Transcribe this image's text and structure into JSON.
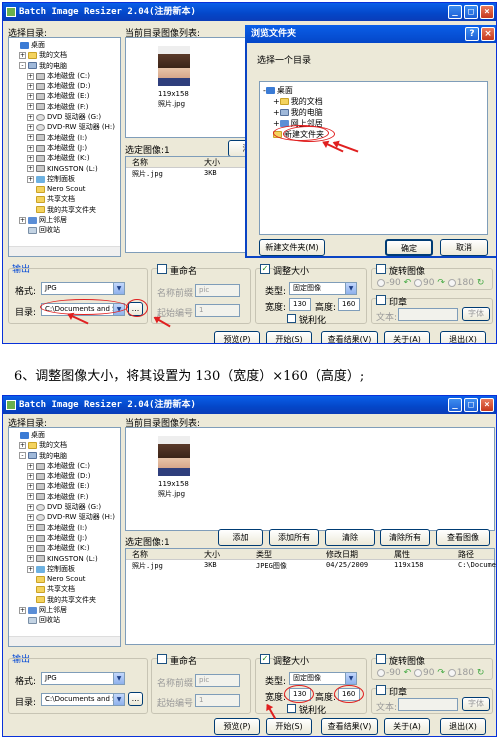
{
  "app": {
    "title": "Batch Image Resizer 2.04(注册新本)"
  },
  "labels": {
    "select_dir": "选择目录:",
    "current_dir_images": "当前目录图像列表:",
    "selected_count": "选定图像:1",
    "output": "输出",
    "format": "格式:",
    "directory": "目录:",
    "rename": "重命名",
    "name_prefix": "名称前缀",
    "start_number": "起始编号",
    "resize": "调整大小",
    "type": "类型:",
    "width": "宽度:",
    "height": "高度:",
    "sharpen": "锐利化",
    "rotate": "旋转图像",
    "watermark": "印章",
    "text": "文本:",
    "font": "字体"
  },
  "tree": [
    {
      "label": "桌面",
      "icon": "desktop-icon",
      "level": 0
    },
    {
      "label": "我的文档",
      "icon": "folder-icon",
      "level": 1,
      "toggle": "+"
    },
    {
      "label": "我的电脑",
      "icon": "computer-icon",
      "level": 1,
      "toggle": "-"
    },
    {
      "label": "本地磁盘 (C:)",
      "icon": "drive-icon",
      "level": 2,
      "toggle": "+"
    },
    {
      "label": "本地磁盘 (D:)",
      "icon": "drive-icon",
      "level": 2,
      "toggle": "+"
    },
    {
      "label": "本地磁盘 (E:)",
      "icon": "drive-icon",
      "level": 2,
      "toggle": "+"
    },
    {
      "label": "本地磁盘 (F:)",
      "icon": "drive-icon",
      "level": 2,
      "toggle": "+"
    },
    {
      "label": "DVD 驱动器 (G:)",
      "icon": "cd-icon",
      "level": 2,
      "toggle": "+"
    },
    {
      "label": "DVD-RW 驱动器 (H:)",
      "icon": "cd-icon",
      "level": 2,
      "toggle": "+"
    },
    {
      "label": "本地磁盘 (I:)",
      "icon": "drive-icon",
      "level": 2,
      "toggle": "+"
    },
    {
      "label": "本地磁盘 (J:)",
      "icon": "drive-icon",
      "level": 2,
      "toggle": "+"
    },
    {
      "label": "本地磁盘 (K:)",
      "icon": "drive-icon",
      "level": 2,
      "toggle": "+"
    },
    {
      "label": "KINGSTON (L:)",
      "icon": "drive-icon",
      "level": 2,
      "toggle": "+"
    },
    {
      "label": "控制面板",
      "icon": "control-panel-icon",
      "level": 2,
      "toggle": "+"
    },
    {
      "label": "Nero Scout",
      "icon": "folder-icon",
      "level": 2
    },
    {
      "label": "共享文档",
      "icon": "folder-icon",
      "level": 2
    },
    {
      "label": "我的共享文件夹",
      "icon": "folder-icon",
      "level": 2
    },
    {
      "label": "网上邻居",
      "icon": "network-icon",
      "level": 1,
      "toggle": "+"
    },
    {
      "label": "回收站",
      "icon": "recycle-bin-icon",
      "level": 1
    }
  ],
  "thumbnail": {
    "size": "119x158",
    "name": "照片.jpg"
  },
  "buttons": {
    "add": "添加",
    "add_all": "添加所有",
    "clear": "清除",
    "clear_all": "清除所有",
    "view_image": "查看图像",
    "preview": "预览(P)",
    "start": "开始(S)",
    "view_result": "查看结果(V)",
    "about": "关于(A)",
    "exit": "退出(X)",
    "browse": "..."
  },
  "file_list": {
    "columns": [
      "名称",
      "大小",
      "类型",
      "修改日期",
      "属性",
      "路径"
    ],
    "rows": [
      [
        "照片.jpg",
        "3KB",
        "JPEG图像",
        "04/25/2009",
        "119x158",
        "C:\\Docume"
      ]
    ]
  },
  "output": {
    "format_value": "JPG",
    "dir_value": "C:\\Documents and S",
    "prefix_value": "pic",
    "start_value": "1"
  },
  "resize": {
    "type_value": "固定图像",
    "width": "130",
    "height": "160"
  },
  "rotate": {
    "options": [
      "-90",
      "90",
      "180"
    ]
  },
  "dialog": {
    "title": "浏览文件夹",
    "help": "?",
    "close": "×",
    "prompt": "选择一个目录",
    "tree": [
      {
        "label": "桌面",
        "icon": "desktop-icon",
        "level": 0,
        "toggle": "-"
      },
      {
        "label": "我的文档",
        "icon": "folder-icon",
        "level": 1,
        "toggle": "+"
      },
      {
        "label": "我的电脑",
        "icon": "computer-icon",
        "level": 1,
        "toggle": "+"
      },
      {
        "label": "网上邻居",
        "icon": "network-icon",
        "level": 1,
        "toggle": "+"
      },
      {
        "label": "新建文件夹",
        "icon": "folder-icon",
        "level": 1
      }
    ],
    "new_folder": "新建文件夹(M)",
    "ok": "确定",
    "cancel": "取消"
  },
  "caption": "6、调整图像大小，将其设置为 130（宽度）×160（高度）;",
  "colors": {
    "titlebar": "#0a5fe8",
    "annotation": "#e02020",
    "face": "#ece9d8"
  }
}
